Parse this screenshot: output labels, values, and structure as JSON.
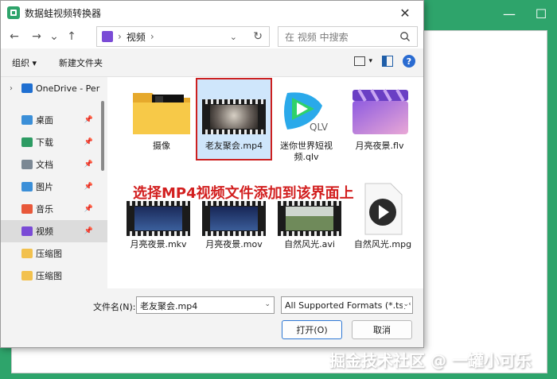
{
  "window": {
    "title": "数据蛙视频转换器",
    "close_glyph": "✕"
  },
  "background_app": {
    "minimize_glyph": "—",
    "maximize_glyph": "☐"
  },
  "nav": {
    "back": "←",
    "forward": "→",
    "history": "⌄",
    "up": "↑",
    "breadcrumb": [
      "视频"
    ],
    "breadcrumb_sep": "›",
    "dropdown": "⌄",
    "refresh": "↻"
  },
  "search": {
    "placeholder": "在 视频 中搜索"
  },
  "toolbar": {
    "organize": "组织 ▾",
    "new_folder": "新建文件夹",
    "view_dropdown": "▾",
    "help": "?"
  },
  "sidebar": {
    "items": [
      {
        "label": "OneDrive - Per",
        "icon": "cloud-icon",
        "chevron": "›",
        "pinned": false
      },
      {
        "label": "桌面",
        "icon": "desktop-icon",
        "chevron": "",
        "pinned": true
      },
      {
        "label": "下载",
        "icon": "download-icon",
        "chevron": "",
        "pinned": true
      },
      {
        "label": "文档",
        "icon": "document-icon",
        "chevron": "",
        "pinned": true
      },
      {
        "label": "图片",
        "icon": "picture-icon",
        "chevron": "",
        "pinned": true
      },
      {
        "label": "音乐",
        "icon": "music-icon",
        "chevron": "",
        "pinned": true
      },
      {
        "label": "视频",
        "icon": "video-icon",
        "chevron": "",
        "pinned": true,
        "active": true
      },
      {
        "label": "压缩图",
        "icon": "folder-icon",
        "chevron": "",
        "pinned": false
      },
      {
        "label": "压缩图",
        "icon": "folder-icon",
        "chevron": "",
        "pinned": false
      }
    ],
    "pin_glyph": "📌"
  },
  "files": [
    {
      "name": "摄像",
      "type": "folder"
    },
    {
      "name": "老友聚会.mp4",
      "type": "video",
      "selected": true
    },
    {
      "name": "迷你世界短视频.qlv",
      "type": "qlv"
    },
    {
      "name": "月亮夜景.flv",
      "type": "flv"
    },
    {
      "name": "月亮夜景.mkv",
      "type": "video"
    },
    {
      "name": "月亮夜景.mov",
      "type": "video"
    },
    {
      "name": "自然风光.avi",
      "type": "video"
    },
    {
      "name": "自然风光.mpg",
      "type": "mpg"
    }
  ],
  "qlv_badge": "QLV",
  "annotation": "选择MP4视频文件添加到该界面上",
  "footer": {
    "filename_label": "文件名(N):",
    "filename_value": "老友聚会.mp4",
    "filetype_value": "All Supported Formats (*.ts;*",
    "open_button": "打开(O)",
    "cancel_button": "取消",
    "dropdown": "⌄"
  },
  "watermark": "掘金技术社区 @ 一罐小可乐",
  "colors": {
    "accent_green": "#2ea46b",
    "selection_border": "#cc2020",
    "selection_fill": "#cfe6fb",
    "annotation_red": "#d21f1f"
  }
}
